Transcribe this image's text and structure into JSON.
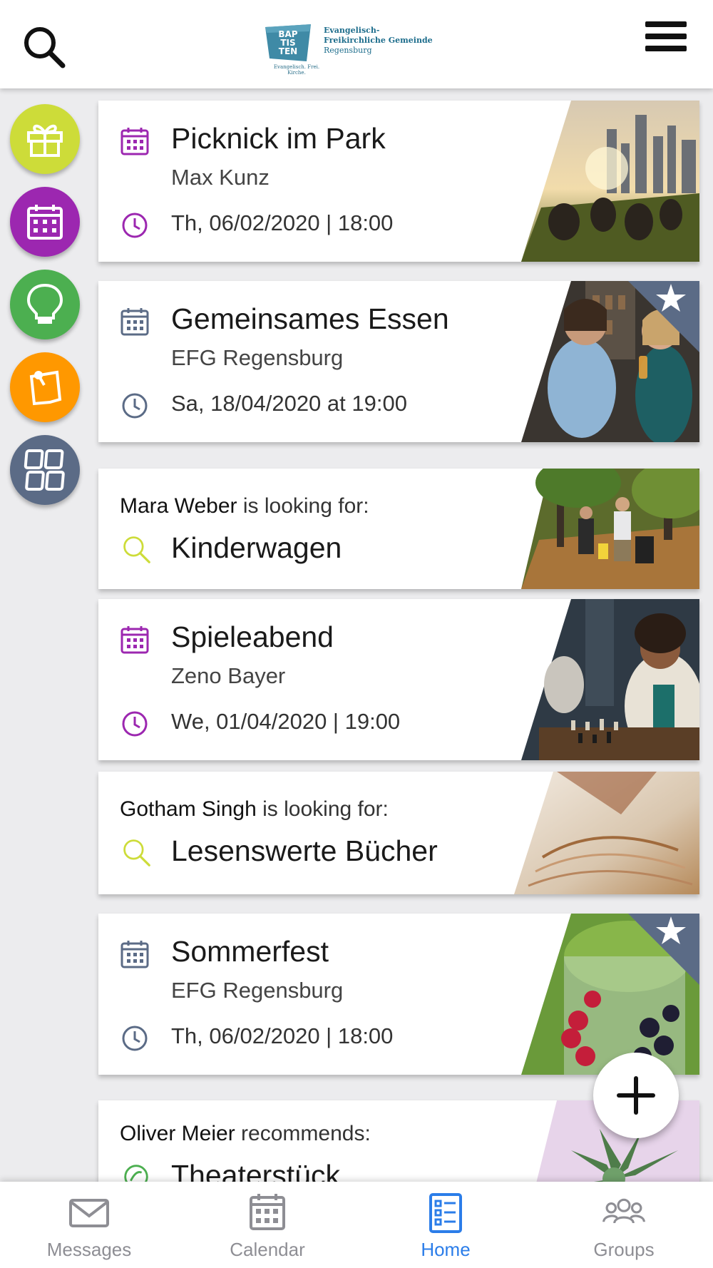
{
  "header": {
    "logo": {
      "badge": "BAPTISTEN",
      "badge_lines": [
        "BAP",
        "TIS",
        "TEN"
      ],
      "tagline": "Evangelisch. Frei. Kirche.",
      "line1": "Evangelisch-",
      "line2": "Freikirchliche Gemeinde",
      "line3": "Regensburg"
    }
  },
  "sidebar": {
    "items": [
      {
        "name": "gift",
        "icon": "gift-icon",
        "color": "#cddc39"
      },
      {
        "name": "calendar",
        "icon": "calendar-icon",
        "color": "#9c27b0"
      },
      {
        "name": "ideas",
        "icon": "lightbulb-icon",
        "color": "#4caf50"
      },
      {
        "name": "notes",
        "icon": "note-pin-icon",
        "color": "#ff9800"
      },
      {
        "name": "categories",
        "icon": "grid-icon",
        "color": "#5b6b86"
      }
    ]
  },
  "feed": {
    "cards": [
      {
        "type": "event",
        "title": "Picknick im Park",
        "subtitle": "Max Kunz",
        "time": "Th, 06/02/2020 | 18:00",
        "accent": "#9c27b0",
        "starred": false
      },
      {
        "type": "event",
        "title": "Gemeinsames Essen",
        "subtitle": "EFG Regensburg",
        "time": "Sa, 18/04/2020 at 19:00",
        "accent": "#5b6b86",
        "starred": true
      },
      {
        "type": "search",
        "person": "Mara Weber",
        "phrase": "is looking for:",
        "title": "Kinderwagen",
        "accent": "#cddc39"
      },
      {
        "type": "event",
        "title": "Spieleabend",
        "subtitle": "Zeno Bayer",
        "time": "We, 01/04/2020 | 19:00",
        "accent": "#9c27b0",
        "starred": false
      },
      {
        "type": "search",
        "person": "Gotham Singh",
        "phrase": "is looking for:",
        "title": "Lesenswerte Bücher",
        "accent": "#cddc39"
      },
      {
        "type": "event",
        "title": "Sommerfest",
        "subtitle": "EFG Regensburg",
        "time": "Th, 06/02/2020 | 18:00",
        "accent": "#5b6b86",
        "starred": true
      },
      {
        "type": "recommend",
        "person": "Oliver Meier",
        "phrase": "recommends:",
        "title": "Theaterstück",
        "accent": "#4caf50"
      }
    ]
  },
  "fab": {
    "icon": "plus-icon"
  },
  "bottom_nav": {
    "items": [
      {
        "label": "Messages",
        "icon": "mail-icon",
        "active": false
      },
      {
        "label": "Calendar",
        "icon": "calendar-icon",
        "active": false
      },
      {
        "label": "Home",
        "icon": "list-icon",
        "active": true
      },
      {
        "label": "Groups",
        "icon": "groups-icon",
        "active": false
      }
    ],
    "active_color": "#2b7de9",
    "inactive_color": "#8e8e94"
  }
}
